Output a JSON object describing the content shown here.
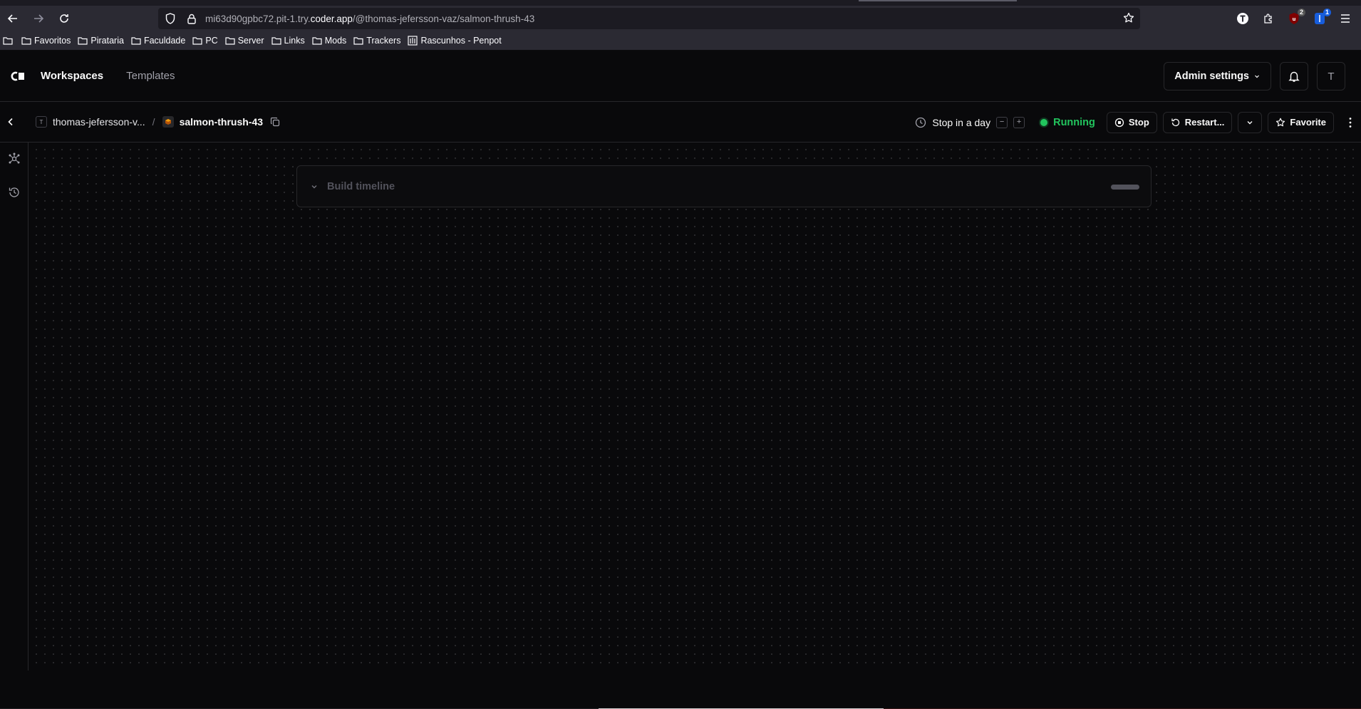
{
  "browser": {
    "url_prefix": "mi63d90gpbc72.pit-1.try.",
    "url_domain": "coder.app",
    "url_path": "/@thomas-jefersson-vaz/salmon-thrush-43",
    "extensions": [
      {
        "icon": "t-extension-icon",
        "label": "T",
        "badge": ""
      },
      {
        "icon": "puzzle-icon",
        "label": "",
        "badge": ""
      },
      {
        "icon": "ublock-icon",
        "label": "",
        "badge": "2"
      },
      {
        "icon": "bitwarden-icon",
        "label": "",
        "badge": "1"
      }
    ],
    "bookmarks": [
      "Favoritos",
      "Pirataria",
      "Faculdade",
      "PC",
      "Server",
      "Links",
      "Mods",
      "Trackers",
      "Rascunhos - Penpot"
    ]
  },
  "header": {
    "nav": {
      "workspaces": "Workspaces",
      "templates": "Templates"
    },
    "admin_settings": "Admin settings",
    "avatar_initial": "T"
  },
  "topbar": {
    "user_initial": "T",
    "user": "thomas-jefersson-v...",
    "separator": "/",
    "workspace": "salmon-thrush-43",
    "schedule": "Stop in a day",
    "decrease": "−",
    "increase": "+",
    "status": "Running",
    "stop": "Stop",
    "restart": "Restart...",
    "favorite": "Favorite"
  },
  "timeline": {
    "title": "Build timeline"
  },
  "colors": {
    "accent_running": "#22c55e",
    "background": "#09090b",
    "border": "#27272a"
  }
}
